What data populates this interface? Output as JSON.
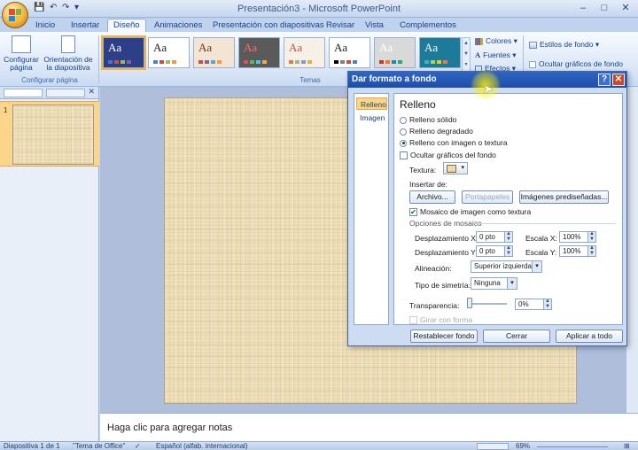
{
  "window": {
    "title": "Presentación3 - Microsoft PowerPoint",
    "minimize": "–",
    "maximize": "□",
    "close": "✕"
  },
  "qat": {
    "save": "💾",
    "undo": "↶",
    "redo": "↷",
    "more": "▾"
  },
  "tabs": [
    "Inicio",
    "Insertar",
    "Diseño",
    "Animaciones",
    "Presentación con diapositivas",
    "Revisar",
    "Vista",
    "Complementos"
  ],
  "active_tab": "Diseño",
  "ribbon": {
    "page_setup_label": "Configurar página",
    "orientation_label": "Orientación de la diapositiva",
    "page_setup_group": "Configurar página",
    "themes_group": "Temas",
    "colors": "Colores",
    "fonts": "Fuentes",
    "effects": "Efectos",
    "bg_styles": "Estilos de fondo",
    "hide_bg": "Ocultar gráficos de fondo",
    "themes": [
      {
        "label": "Aa",
        "bg": "#2d3f86",
        "fg": "#ffffff",
        "bars": [
          "#4b74c6",
          "#c0504d",
          "#9bbb59",
          "#8064a2"
        ]
      },
      {
        "label": "Aa",
        "bg": "#ffffff",
        "fg": "#222222",
        "bars": [
          "#4f81bd",
          "#c0504d",
          "#9bbb59",
          "#f79646"
        ]
      },
      {
        "label": "Aa",
        "bg": "#f3e4d4",
        "fg": "#6a3a1a",
        "bars": [
          "#c0504d",
          "#8064a2",
          "#4bacc6",
          "#f79646"
        ]
      },
      {
        "label": "Aa",
        "bg": "#5a5a5a",
        "fg": "#ff6b6b",
        "bars": [
          "#d9534f",
          "#5cb85c",
          "#5bc0de",
          "#f0ad4e"
        ]
      },
      {
        "label": "Aa",
        "bg": "#f7f0e6",
        "fg": "#b15b3a",
        "bars": [
          "#d17f52",
          "#a5b592",
          "#7d9cc4",
          "#e3b04b"
        ]
      },
      {
        "label": "Aa",
        "bg": "#ffffff",
        "fg": "#222222",
        "bars": [
          "#000000",
          "#7f7f7f",
          "#c0504d",
          "#4f81bd"
        ]
      },
      {
        "label": "Aa",
        "bg": "#d9d9d9",
        "fg": "#ffffff",
        "bars": [
          "#c0392b",
          "#e67e22",
          "#2980b9",
          "#27ae60"
        ]
      },
      {
        "label": "Aa",
        "bg": "#1d7b9a",
        "fg": "#ffffff",
        "bars": [
          "#3fb1c9",
          "#a3d65c",
          "#f0c419",
          "#ef7a3c"
        ]
      }
    ]
  },
  "slide": {
    "number": "1",
    "notes_placeholder": "Haga clic para agregar notas"
  },
  "status": {
    "slide_info": "Diapositiva 1 de 1",
    "theme": "\"Tema de Office\"",
    "language": "Español (alfab. internacional)",
    "zoom": "69%"
  },
  "dialog": {
    "title": "Dar formato a fondo",
    "help": "?",
    "close": "✕",
    "nav": [
      "Relleno",
      "Imagen"
    ],
    "section": "Relleno",
    "fill_options": [
      "Relleno sólido",
      "Relleno degradado",
      "Relleno con imagen o textura"
    ],
    "hide_bg_graphics": "Ocultar gráficos del fondo",
    "texture_label": "Textura:",
    "insert_from": "Insertar de:",
    "btn_file": "Archivo...",
    "btn_clipboard": "Portapapeles",
    "btn_clipart": "Imágenes prediseñadas...",
    "tile_label": "Mosaico de imagen como textura",
    "tile_options": "Opciones de mosaico",
    "offset_x_label": "Desplazamiento X:",
    "offset_x": "0 pto",
    "scale_x_label": "Escala X:",
    "scale_x": "100%",
    "offset_y_label": "Desplazamiento Y:",
    "offset_y": "0 pto",
    "scale_y_label": "Escala Y:",
    "scale_y": "100%",
    "align_label": "Alineación:",
    "align_value": "Superior izquierda",
    "mirror_label": "Tipo de simetría:",
    "mirror_value": "Ninguna",
    "transparency_label": "Transparencia:",
    "transparency_value": "0%",
    "rotate_label": "Girar con forma",
    "btn_reset": "Restablecer fondo",
    "btn_close": "Cerrar",
    "btn_apply_all": "Aplicar a todo"
  }
}
